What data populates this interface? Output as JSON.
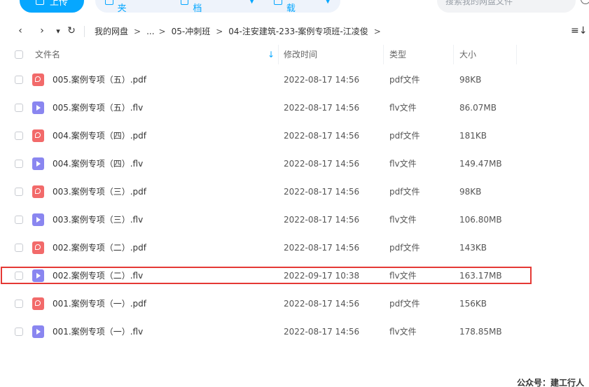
{
  "toolbar": {
    "upload_label": "上传",
    "new_folder_label": "新建文件夹",
    "new_online_doc_label": "新建在线文档",
    "offline_download_label": "离线下载",
    "search_placeholder": "搜索我的网盘文件"
  },
  "pathbar": {
    "back_icon": "‹",
    "forward_icon": "›",
    "dropdown_icon": "▾",
    "refresh_icon": "↻",
    "crumbs": [
      "我的网盘",
      "...",
      "05-冲刺班",
      "04-注安建筑-233-案例专项班-江凌俊"
    ],
    "separator": ">",
    "sort_icon": "≡↓"
  },
  "table": {
    "headers": {
      "name": "文件名",
      "modified": "修改时间",
      "type": "类型",
      "size": "大小"
    },
    "rows": [
      {
        "icon": "pdf",
        "name": "005.案例专项（五）.pdf",
        "modified": "2022-08-17 14:56",
        "type": "pdf文件",
        "size": "98KB"
      },
      {
        "icon": "flv",
        "name": "005.案例专项（五）.flv",
        "modified": "2022-08-17 14:56",
        "type": "flv文件",
        "size": "86.07MB"
      },
      {
        "icon": "pdf",
        "name": "004.案例专项（四）.pdf",
        "modified": "2022-08-17 14:56",
        "type": "pdf文件",
        "size": "181KB"
      },
      {
        "icon": "flv",
        "name": "004.案例专项（四）.flv",
        "modified": "2022-08-17 14:56",
        "type": "flv文件",
        "size": "149.47MB"
      },
      {
        "icon": "pdf",
        "name": "003.案例专项（三）.pdf",
        "modified": "2022-08-17 14:56",
        "type": "pdf文件",
        "size": "98KB"
      },
      {
        "icon": "flv",
        "name": "003.案例专项（三）.flv",
        "modified": "2022-08-17 14:56",
        "type": "flv文件",
        "size": "106.80MB"
      },
      {
        "icon": "pdf",
        "name": "002.案例专项（二）.pdf",
        "modified": "2022-08-17 14:56",
        "type": "pdf文件",
        "size": "143KB"
      },
      {
        "icon": "flv",
        "name": "002.案例专项（二）.flv",
        "modified": "2022-09-17 10:38",
        "type": "flv文件",
        "size": "163.17MB"
      },
      {
        "icon": "pdf",
        "name": "001.案例专项（一）.pdf",
        "modified": "2022-08-17 14:56",
        "type": "pdf文件",
        "size": "156KB"
      },
      {
        "icon": "flv",
        "name": "001.案例专项（一）.flv",
        "modified": "2022-08-17 14:56",
        "type": "flv文件",
        "size": "178.85MB"
      }
    ]
  },
  "watermark": "公众号：建工行人",
  "colors": {
    "accent": "#06a7ff",
    "highlight": "#e53935",
    "pdf_icon": "#f26a6a",
    "flv_icon": "#8a86f0"
  }
}
